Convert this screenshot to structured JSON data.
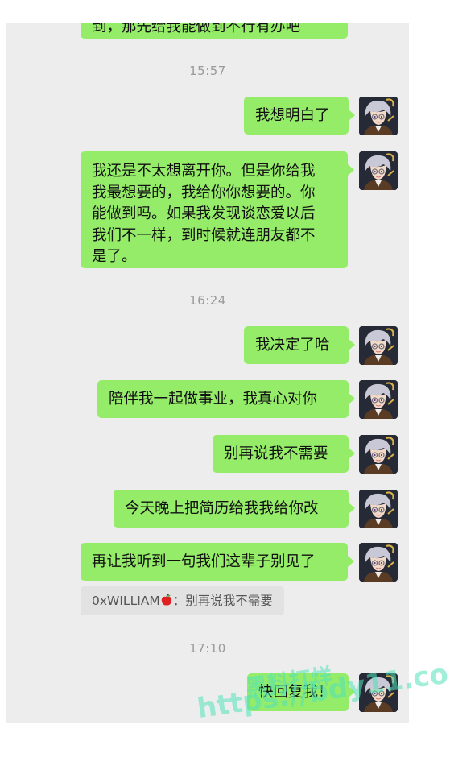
{
  "top_partial_text": "到，那先给我能做到不行有办吧",
  "timestamps": [
    "15:57",
    "16:24",
    "17:10"
  ],
  "messages": [
    {
      "text": "我想明白了"
    },
    {
      "lines": [
        "我还是不太想离开你。但是你给我",
        "我最想要的，我给你你想要的。你",
        "能做到吗。如果我发现谈恋爱以后",
        "我们不一样，到时候就连朋友都不",
        "是了。"
      ]
    },
    {
      "text": "我决定了哈"
    },
    {
      "text": "陪伴我一起做事业，我真心对你"
    },
    {
      "text": "别再说我不需要"
    },
    {
      "text": "今天晚上把简历给我我给你改"
    },
    {
      "text": "再让我听到一句我们这辈子别见了"
    },
    {
      "text": "快回复我！"
    }
  ],
  "quote": {
    "sender": "0xWILLIAM",
    "separator": "：",
    "text": "别再说我不需要"
  },
  "watermark": {
    "cn": "黑料打烊",
    "url": "https://bdy11.co"
  },
  "colors": {
    "bubble": "#95ec69",
    "background": "#ededed",
    "timestamp": "#9a9a9a"
  },
  "icons": {
    "avatar": "anime-avatar-icon",
    "apple": "red-apple-icon"
  }
}
